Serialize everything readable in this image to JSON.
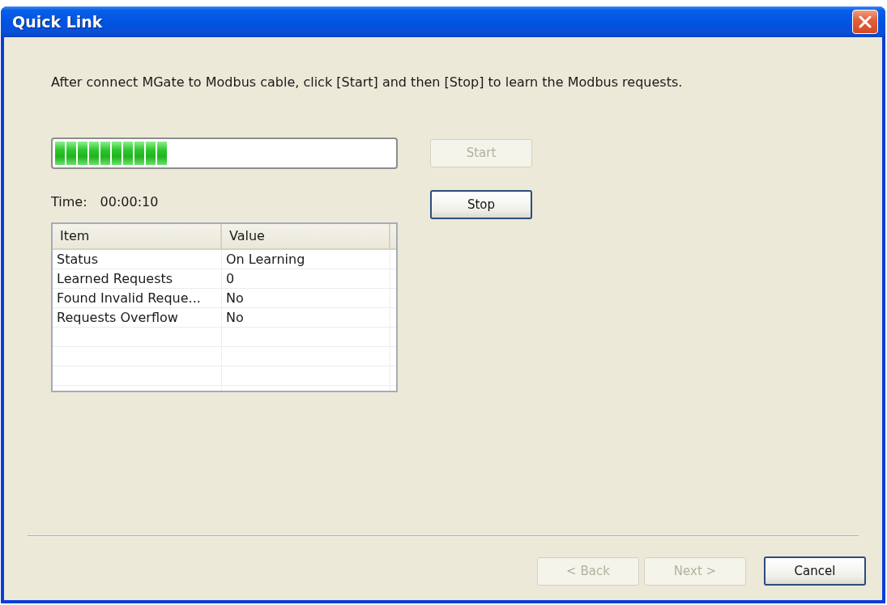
{
  "window": {
    "title": "Quick Link"
  },
  "instruction": "After connect MGate to Modbus cable, click [Start] and then [Stop] to learn the Modbus requests.",
  "progress": {
    "level": 0.33
  },
  "time": {
    "label": "Time:",
    "value": "00:00:10"
  },
  "side_buttons": [
    {
      "label": "Start",
      "disabled": true
    },
    {
      "label": "Stop",
      "disabled": false
    }
  ],
  "table": {
    "columns": [
      "Item",
      "Value"
    ],
    "rows": [
      [
        "Status",
        "On Learning"
      ],
      [
        "Learned Requests",
        "0"
      ],
      [
        "Found Invalid Reque...",
        "No"
      ],
      [
        "Requests Overflow",
        "No"
      ]
    ]
  },
  "footer_buttons": [
    {
      "label": "< Back",
      "disabled": true
    },
    {
      "label": "Next >",
      "disabled": true
    },
    {
      "label": "Cancel",
      "disabled": false
    }
  ]
}
